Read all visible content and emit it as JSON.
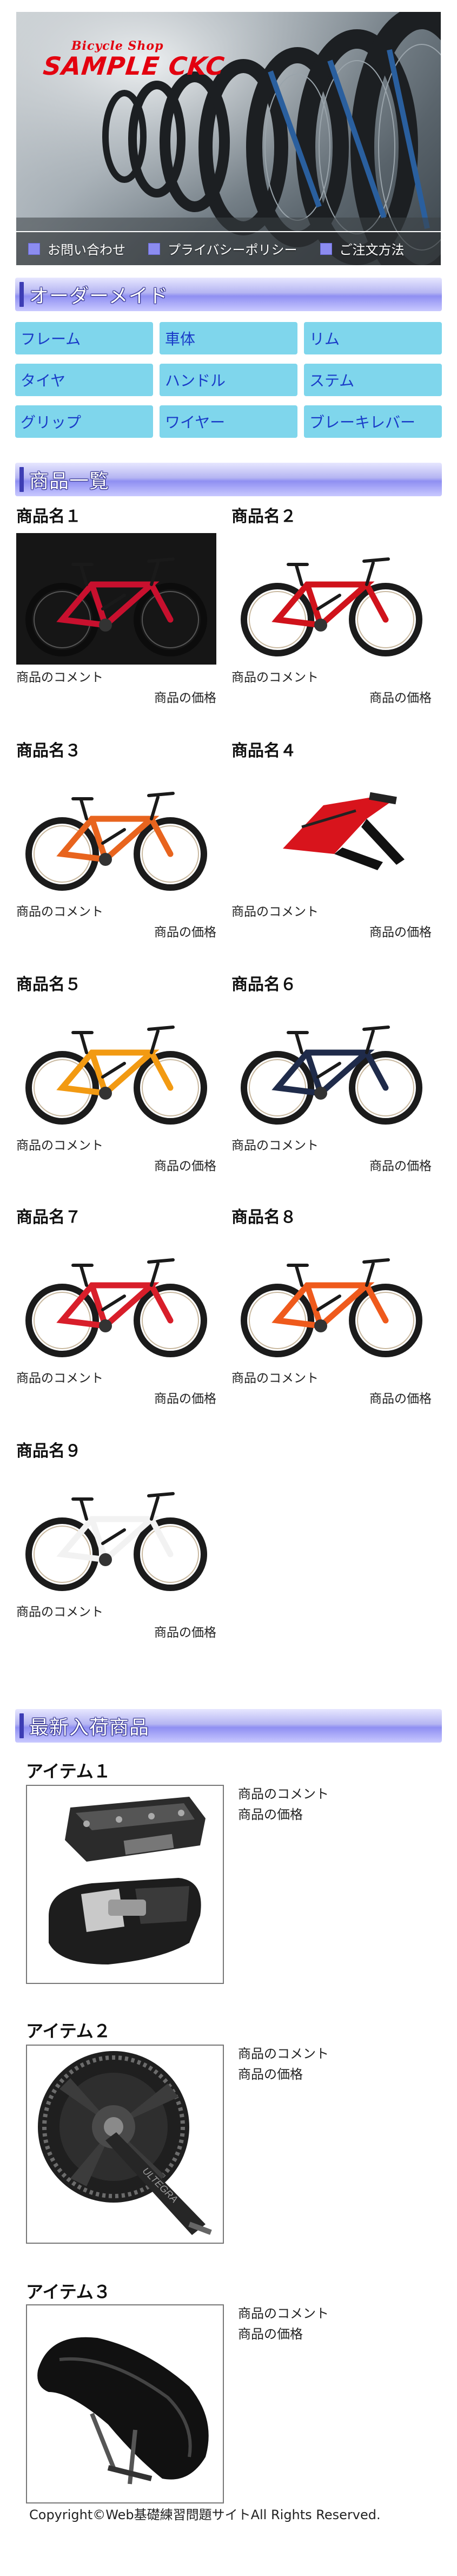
{
  "header": {
    "logo_sub": "Bicycle Shop",
    "logo_main": "SAMPLE CKC",
    "nav": [
      {
        "label": "お問い合わせ",
        "icon": "square-bullet-icon"
      },
      {
        "label": "プライバシーポリシー",
        "icon": "square-bullet-icon"
      },
      {
        "label": "ご注文方法",
        "icon": "square-bullet-icon"
      }
    ]
  },
  "order_section": {
    "title": "オーダーメイド",
    "cells": [
      "フレーム",
      "車体",
      "リム",
      "タイヤ",
      "ハンドル",
      "ステム",
      "グリップ",
      "ワイヤー",
      "ブレーキレバー"
    ]
  },
  "products_section": {
    "title": "商品一覧",
    "items": [
      {
        "name": "商品名１",
        "comment": "商品のコメント",
        "price": "商品の価格",
        "color": "#c8102e"
      },
      {
        "name": "商品名２",
        "comment": "商品のコメント",
        "price": "商品の価格",
        "color": "#d0121b"
      },
      {
        "name": "商品名３",
        "comment": "商品のコメント",
        "price": "商品の価格",
        "color": "#e8641e"
      },
      {
        "name": "商品名４",
        "comment": "商品のコメント",
        "price": "商品の価格",
        "color": "#d8141c"
      },
      {
        "name": "商品名５",
        "comment": "商品のコメント",
        "price": "商品の価格",
        "color": "#f29a12"
      },
      {
        "name": "商品名６",
        "comment": "商品のコメント",
        "price": "商品の価格",
        "color": "#1f2b4a"
      },
      {
        "name": "商品名７",
        "comment": "商品のコメント",
        "price": "商品の価格",
        "color": "#d81e2a"
      },
      {
        "name": "商品名８",
        "comment": "商品のコメント",
        "price": "商品の価格",
        "color": "#ef5a1c"
      },
      {
        "name": "商品名９",
        "comment": "商品のコメント",
        "price": "商品の価格",
        "color": "#f2f2f2"
      }
    ]
  },
  "new_section": {
    "title": "最新入荷商品",
    "items": [
      {
        "name": "アイテム１",
        "comment": "商品のコメント",
        "price": "商品の価格",
        "icon": "pedal-icon"
      },
      {
        "name": "アイテム２",
        "comment": "商品のコメント",
        "price": "商品の価格",
        "icon": "crankset-icon"
      },
      {
        "name": "アイテム３",
        "comment": "商品のコメント",
        "price": "商品の価格",
        "icon": "saddle-icon"
      }
    ]
  },
  "footer": {
    "text": "Copyright©Web基礎練習問題サイトAll Rights Reserved."
  }
}
